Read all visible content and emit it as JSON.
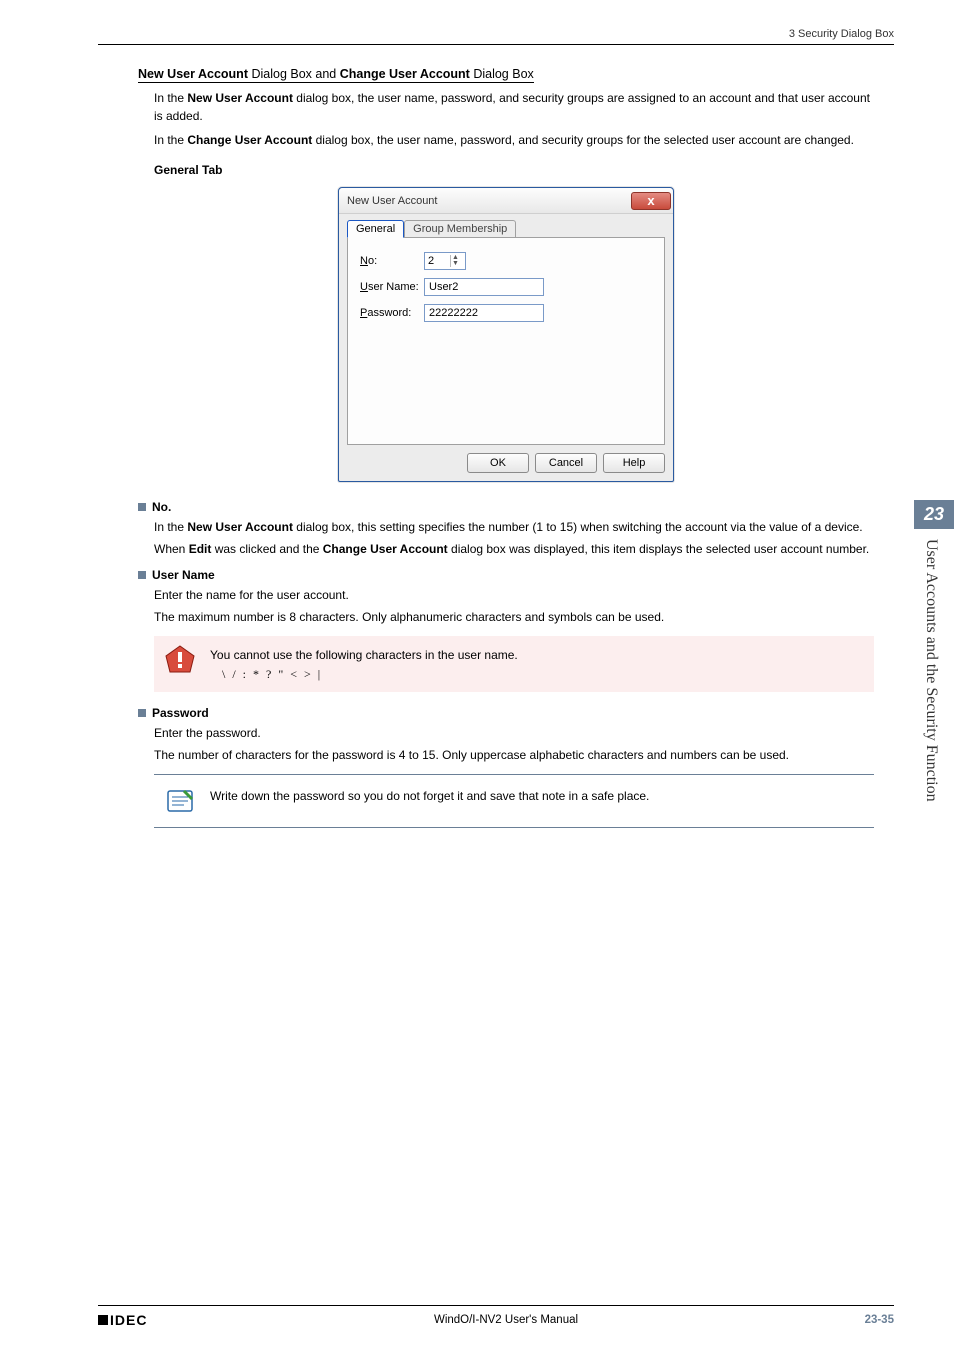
{
  "header": {
    "text": "3 Security Dialog Box"
  },
  "title": {
    "part1_bold": "New User Account",
    "part1_rest": " Dialog Box and ",
    "part2_bold": "Change User Account",
    "part2_rest": " Dialog Box"
  },
  "intro": {
    "p1_pre": "In the ",
    "p1_bold": "New User Account",
    "p1_post": " dialog box, the user name, password, and security groups are assigned to an account and that user account is added.",
    "p2_pre": "In the ",
    "p2_bold": "Change User Account",
    "p2_post": " dialog box, the user name, password, and security groups for the selected user account are changed."
  },
  "general_tab_label": "General Tab",
  "dialog": {
    "title": "New User Account",
    "close_glyph": "x",
    "tabs": {
      "general": "General",
      "group": "Group Membership"
    },
    "fields": {
      "no_label_u": "N",
      "no_label_rest": "o:",
      "no_value": "2",
      "user_label_u": "U",
      "user_label_rest": "ser Name:",
      "user_value": "User2",
      "pass_label_u": "P",
      "pass_label_rest": "assword:",
      "pass_value": "22222222"
    },
    "buttons": {
      "ok": "OK",
      "cancel": "Cancel",
      "help": "Help"
    }
  },
  "sections": {
    "no": {
      "head": "No.",
      "p1_pre": "In the ",
      "p1_bold": "New User Account",
      "p1_post": " dialog box, this setting specifies the number (1 to 15) when switching the account via the value of a device.",
      "p2_pre": "When ",
      "p2_bold1": "Edit",
      "p2_mid": " was clicked and the ",
      "p2_bold2": "Change User Account",
      "p2_post": " dialog box was displayed, this item displays the selected user account number."
    },
    "username": {
      "head": "User Name",
      "p1": "Enter the name for the user account.",
      "p2": "The maximum number is 8 characters. Only alphanumeric characters and symbols can be used.",
      "caution_line1": "You cannot use the following characters in the user name.",
      "caution_chars": "\\ / : * ? \" < > |"
    },
    "password": {
      "head": "Password",
      "p1": "Enter the password.",
      "p2": "The number of characters for the password is 4 to 15. Only uppercase alphabetic characters and numbers can be used.",
      "info": "Write down the password so you do not forget it and save that note in a safe place."
    }
  },
  "sidebar": {
    "num": "23",
    "text": "User Accounts and the Security Function"
  },
  "footer": {
    "logo": "IDEC",
    "center": "WindO/I-NV2 User's Manual",
    "page": "23-35"
  }
}
